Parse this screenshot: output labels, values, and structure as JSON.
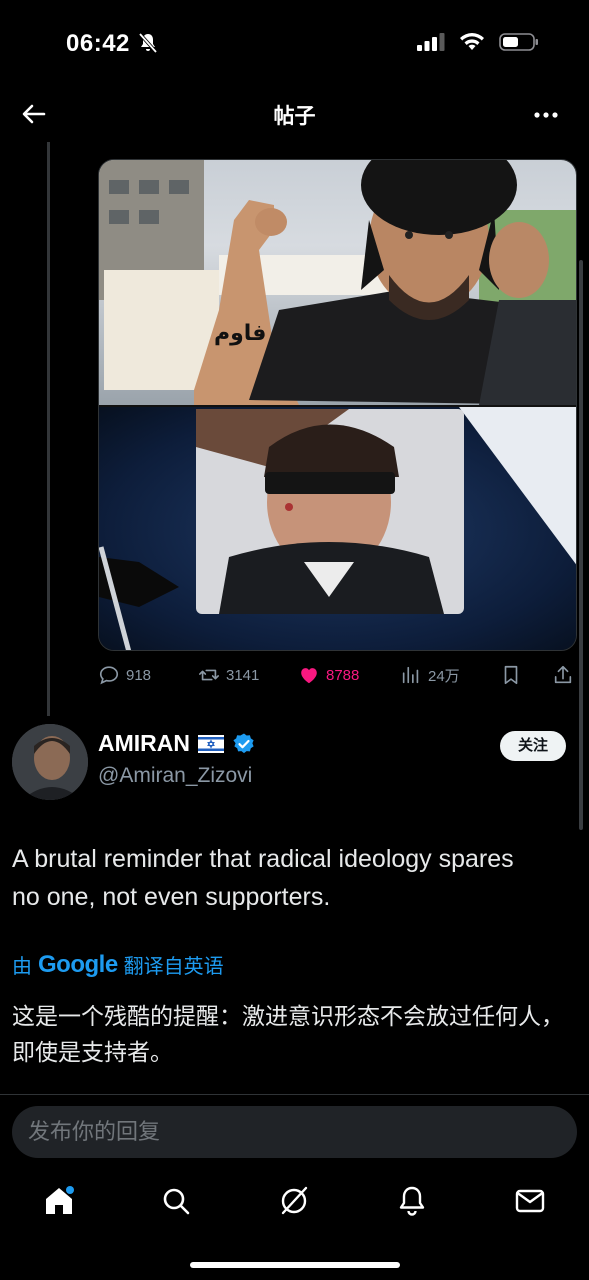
{
  "status": {
    "time": "06:42"
  },
  "nav": {
    "title": "帖子"
  },
  "stats": {
    "replies": "918",
    "reposts": "3141",
    "likes": "8788",
    "views": "24万"
  },
  "author": {
    "name": "AMIRAN",
    "handle": "@Amiran_Zizovi",
    "follow_label": "关注"
  },
  "tweet": {
    "text": "A brutal reminder that radical ideology spares no one, not even supporters.",
    "translated_prefix": "由",
    "translated_brand": "Google",
    "translated_suffix": "翻译自英语",
    "translation": "这是一个残酷的提醒：激进意识形态不会放过任何人，即使是支持者。"
  },
  "reply": {
    "placeholder": "发布你的回复"
  },
  "colors": {
    "accent": "#1d9bf0",
    "like": "#f91880",
    "verified": "#1d9bf0"
  },
  "icons": [
    "back-arrow-icon",
    "more-icon",
    "reply-icon",
    "repost-icon",
    "like-icon",
    "views-icon",
    "bookmark-icon",
    "share-icon",
    "home-icon",
    "search-icon",
    "grok-icon",
    "notifications-icon",
    "messages-icon"
  ]
}
